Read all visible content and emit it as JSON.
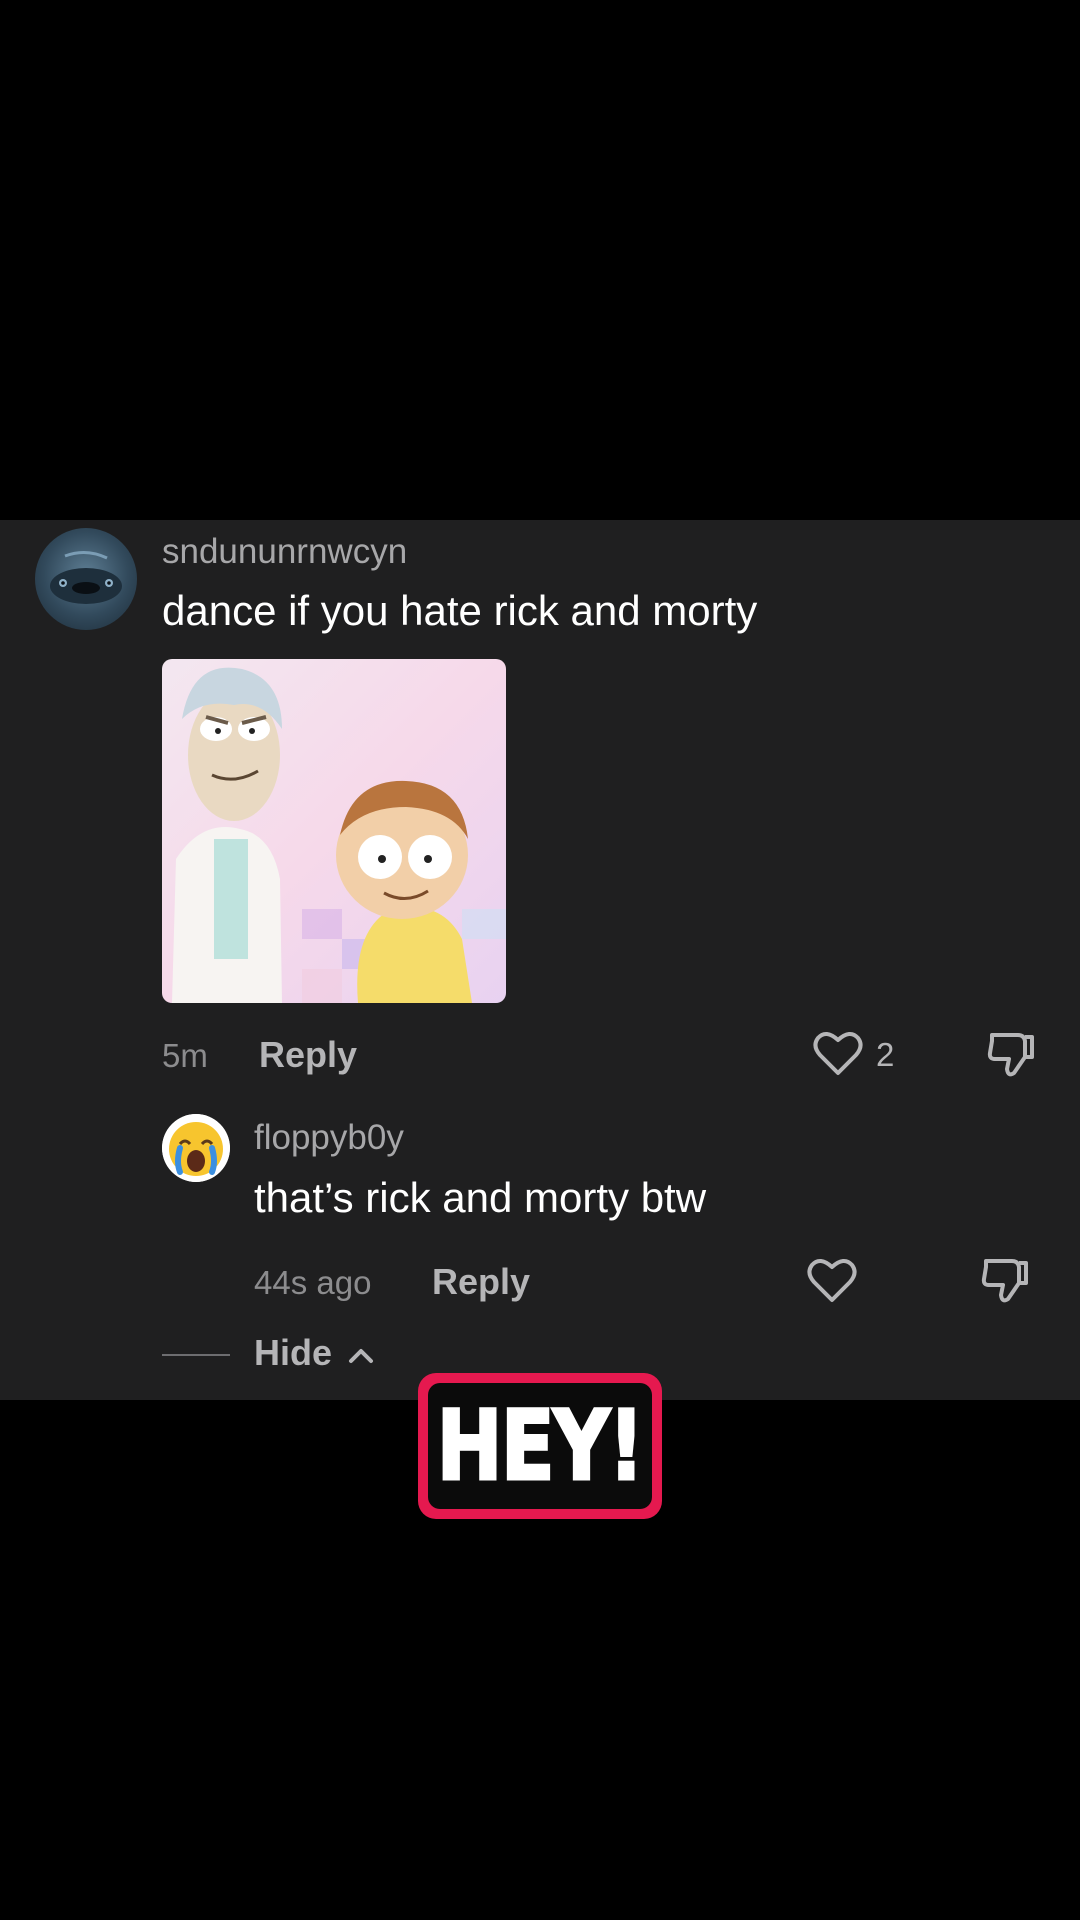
{
  "comment": {
    "username": "sndununrnwcyn",
    "text": "dance if you hate rick and morty",
    "time": "5m",
    "reply_label": "Reply",
    "like_count": "2",
    "avatar_icon": "avatar-image",
    "sticker_icon": "rick-and-morty-sticker"
  },
  "reply": {
    "username": "floppyb0y",
    "text": "that’s rick and morty btw",
    "time": "44s ago",
    "reply_label": "Reply",
    "avatar_icon": "crying-face-emoji"
  },
  "thread": {
    "hide_label": "Hide"
  },
  "overlay": {
    "text": "HEY!",
    "accent_color": "#e5194f"
  },
  "colors": {
    "panel_background": "#1f1f20",
    "page_background": "#000000",
    "muted_text": "#a7a7a9",
    "primary_text": "#ffffff"
  }
}
